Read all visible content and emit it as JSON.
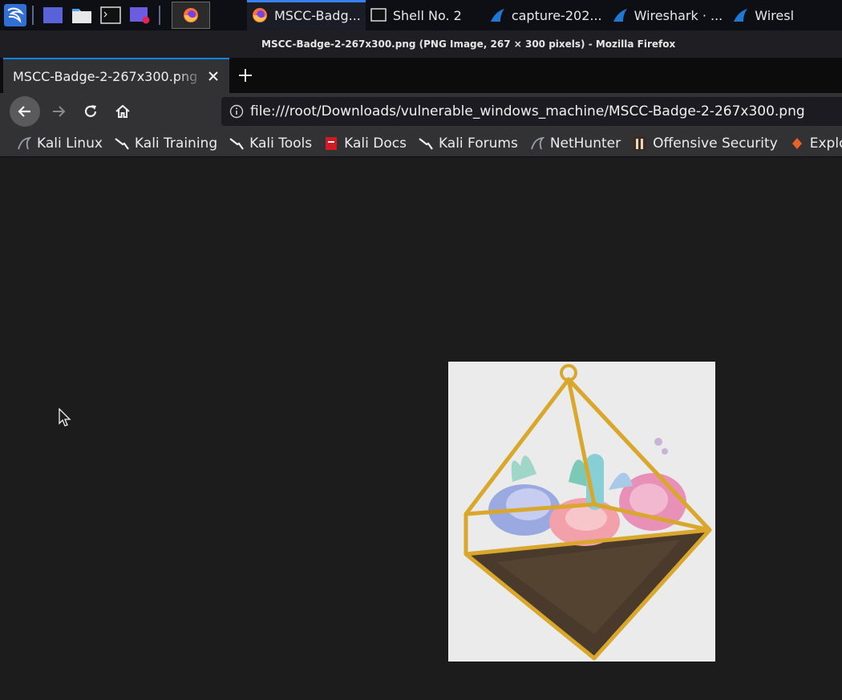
{
  "taskbar": {
    "tasks": [
      {
        "label": "MSCC-Badg...",
        "icon": "firefox-icon",
        "active": true
      },
      {
        "label": "Shell No. 2",
        "icon": "terminal-icon",
        "active": false
      },
      {
        "label": "capture-202...",
        "icon": "wireshark-fin-icon",
        "active": false
      },
      {
        "label": "Wireshark · ...",
        "icon": "wireshark-fin-icon",
        "active": false
      },
      {
        "label": "Wiresl",
        "icon": "wireshark-fin-icon",
        "active": false
      }
    ]
  },
  "window": {
    "title": "MSCC-Badge-2-267x300.png (PNG Image, 267 × 300 pixels) - Mozilla Firefox"
  },
  "tab": {
    "label": "MSCC-Badge-2-267x300.png"
  },
  "urlbar": {
    "url": "file:///root/Downloads/vulnerable_windows_machine/MSCC-Badge-2-267x300.png"
  },
  "bookmarks": [
    {
      "label": "Kali Linux",
      "icon": "kali-dragon-icon"
    },
    {
      "label": "Kali Training",
      "icon": "kali-dragon-icon"
    },
    {
      "label": "Kali Tools",
      "icon": "kali-dragon-icon"
    },
    {
      "label": "Kali Docs",
      "icon": "kali-docs-icon"
    },
    {
      "label": "Kali Forums",
      "icon": "kali-dragon-icon"
    },
    {
      "label": "NetHunter",
      "icon": "kali-dragon-icon"
    },
    {
      "label": "Offensive Security",
      "icon": "offsec-icon"
    },
    {
      "label": "Exploi",
      "icon": "exploit-db-icon"
    }
  ],
  "colors": {
    "accent": "#0a84ff",
    "taskbar": "#0d0f14",
    "toolbar": "#323234",
    "content_bg": "#1c1c1c"
  }
}
